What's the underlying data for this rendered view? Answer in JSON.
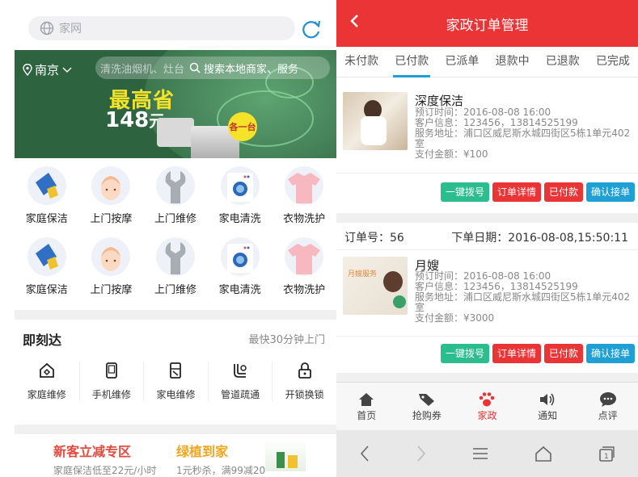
{
  "left": {
    "search_placeholder": "家网",
    "banner": {
      "city": "南京",
      "search_faded": "清洗油烟机、灶台",
      "search_text": "搜索本地商家、服务",
      "promo_line1": "最高省",
      "promo_amount": "148",
      "promo_unit": "元",
      "tag": "各一台"
    },
    "categories_row1": [
      "家庭保洁",
      "上门按摩",
      "上门维修",
      "家电清洗",
      "衣物洗护"
    ],
    "categories_row2": [
      "家庭保洁",
      "上门按摩",
      "上门维修",
      "家电清洗",
      "衣物洗护"
    ],
    "jikeda": {
      "title": "即刻达",
      "subtitle": "最快30分钟上门",
      "items": [
        "家庭维修",
        "手机维修",
        "家电维修",
        "管道疏通",
        "开锁换锁"
      ]
    },
    "bottom": {
      "card1_title": "新客立减专区",
      "card1_sub": "家庭保洁低至22元/小时",
      "card2_title": "绿植到家",
      "card2_sub": "1元秒杀，满99减20"
    }
  },
  "right": {
    "header_title": "家政订单管理",
    "tabs": [
      "未付款",
      "已付款",
      "已派单",
      "退款中",
      "已退款",
      "已完成"
    ],
    "active_tab": 1,
    "orders": [
      {
        "title": "深度保洁",
        "time": "预订时间：2016-08-08 16:00",
        "customer": "客户信息：123456，13814525199",
        "address": "服务地址：浦口区威尼斯水城四街区5栋1单元402室",
        "amount": "支付金额：¥100"
      },
      {
        "order_no": "订单号：56",
        "order_date": "下单日期：2016-08-08,15:50:11",
        "title": "月嫂",
        "time": "预订时间：2016-08-08 16:00",
        "customer": "客户信息：123456，13814525199",
        "address": "服务地址：浦口区威尼斯水城四街区5栋1单元402室",
        "amount": "支付金额：¥3000"
      }
    ],
    "buttons": [
      "一键拨号",
      "订单详情",
      "已付款",
      "确认接单"
    ],
    "nav": [
      "首页",
      "抢购券",
      "家政",
      "通知",
      "点评"
    ],
    "active_nav": 2,
    "accent": "#ea3435",
    "blue": "#1ea0d4",
    "green": "#2bbd8e"
  }
}
